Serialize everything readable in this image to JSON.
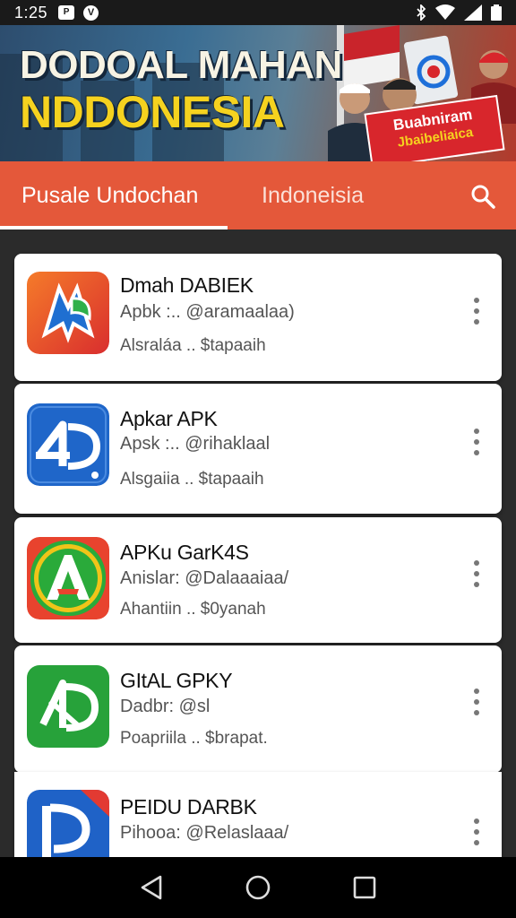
{
  "status_bar": {
    "time": "1:25",
    "left_icons": [
      "notification-badge-icon",
      "v-circle-icon"
    ],
    "right_icons": [
      "bluetooth-icon",
      "wifi-icon",
      "signal-icon",
      "battery-icon"
    ],
    "badge_glyph": "P",
    "circle_glyph": "V"
  },
  "banner": {
    "title_line1": "DODOAL MAHAN",
    "title_line2": "NDDONESIA",
    "sign_line1": "Buabniram",
    "sign_line2": "Jbaibeliaica"
  },
  "tabs": [
    {
      "label": "Pusale Undochan",
      "active": true
    },
    {
      "label": "Indoneisia",
      "active": false
    }
  ],
  "colors": {
    "tab_bar": "#e4583a",
    "card_bg": "#ffffff",
    "page_bg": "#2b2b2b"
  },
  "apps": [
    {
      "name": "Dmah DABIEK",
      "subtitle": "Apbk :.. @aramaalaa)",
      "meta": "Alsraláa .. $tapaaih",
      "icon": "orange-blue-shield-icon"
    },
    {
      "name": "Apkar APK",
      "subtitle": "Apsk :.. @rihaklaal",
      "meta": "Alsgaiia .. $tapaaih",
      "icon": "blue-4d-logo-icon"
    },
    {
      "name": "APKu GarK4S",
      "subtitle": "Anislar: @Dalaaaiaa/",
      "meta": "Ahantiin .. $0yanah",
      "icon": "green-a-logo-icon"
    },
    {
      "name": "GItAL GPKY",
      "subtitle": "Dadbr: @sl",
      "meta": "Poapriila .. $brapat.",
      "icon": "green-d-logo-icon"
    },
    {
      "name": "PEIDU DARBK",
      "subtitle": "Pihooa: @Relaslaaa/",
      "meta": "",
      "icon": "blue-p-logo-icon"
    }
  ],
  "nav": [
    "back-icon",
    "home-icon",
    "recents-icon"
  ]
}
